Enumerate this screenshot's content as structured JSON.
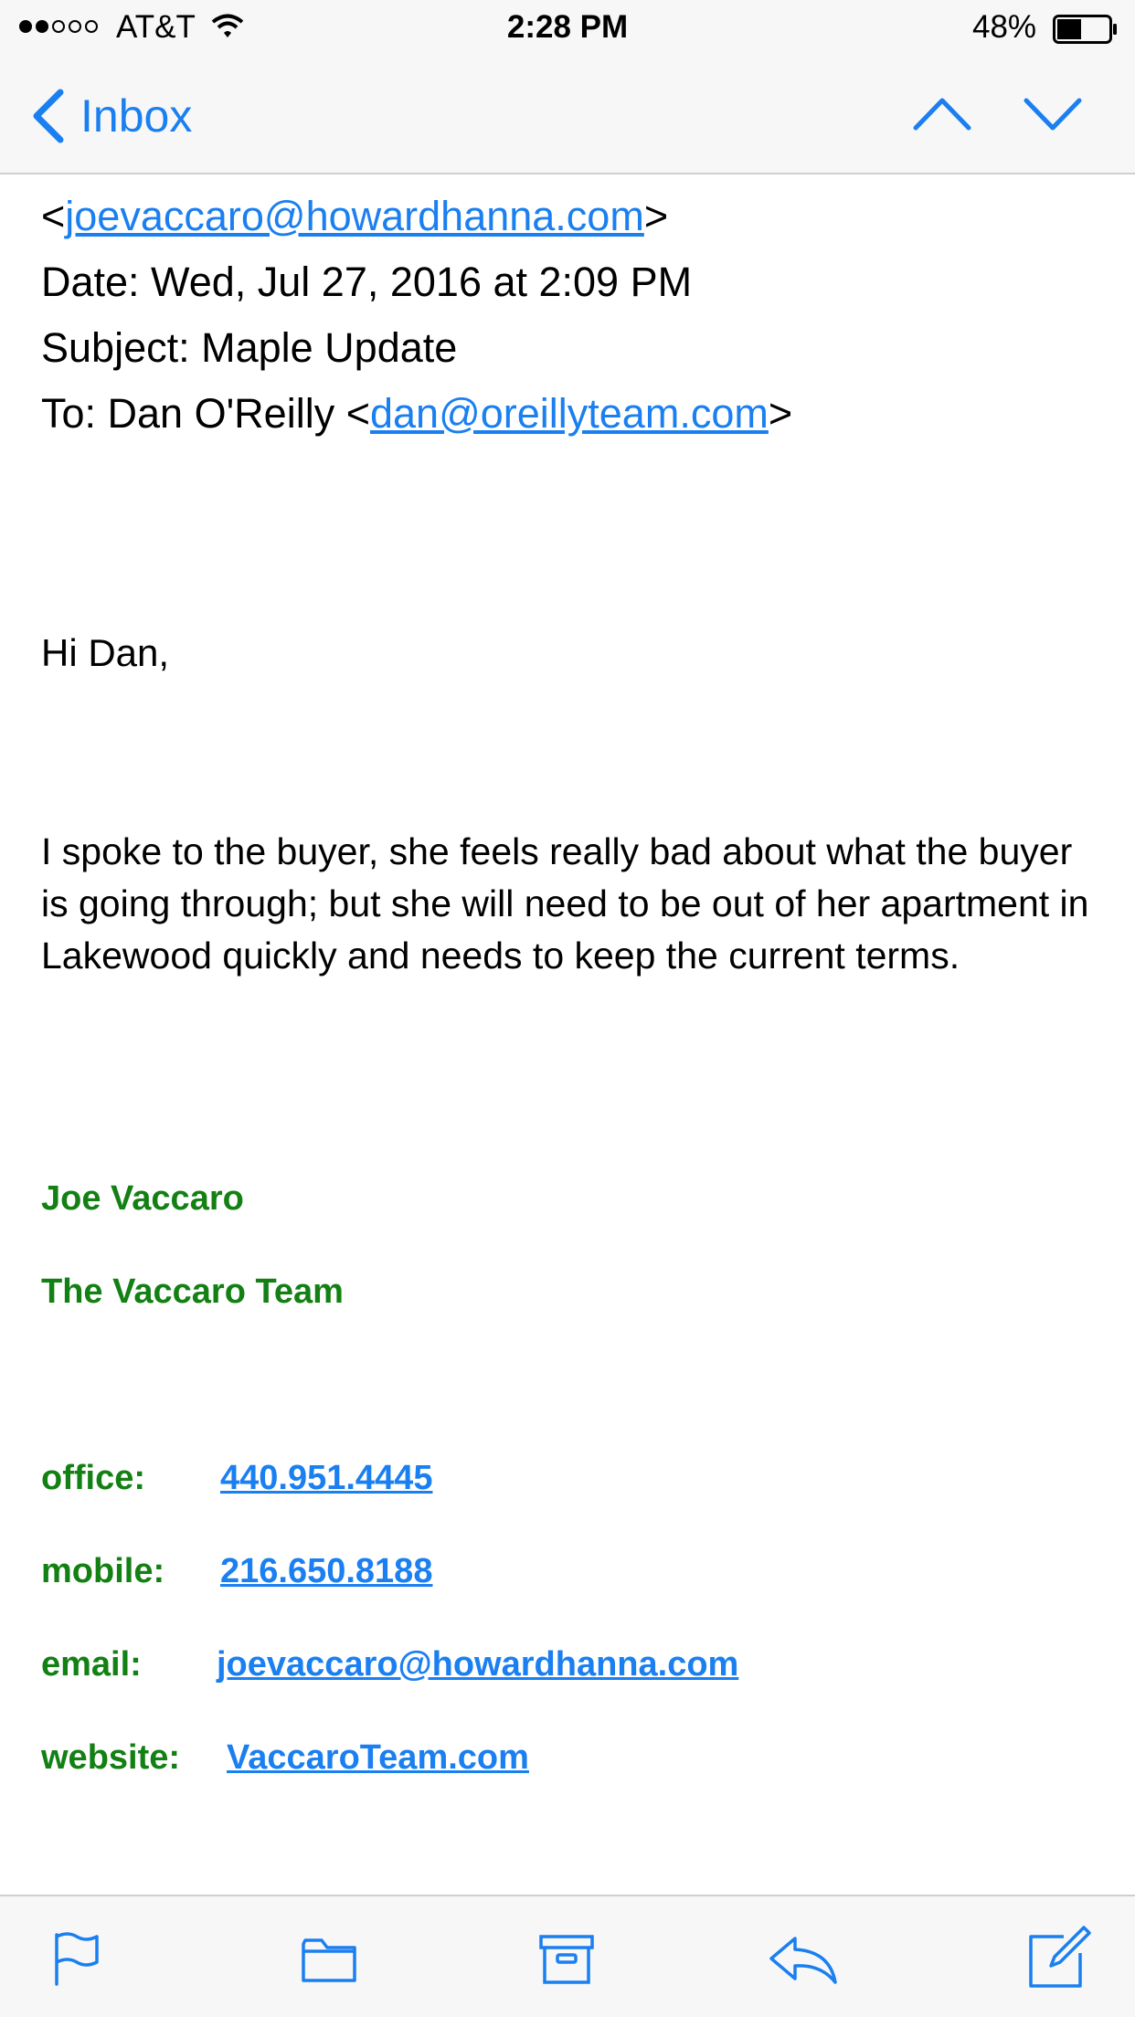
{
  "status_bar": {
    "carrier": "AT&T",
    "time": "2:28 PM",
    "battery_percent": "48%",
    "signal_filled": 2,
    "signal_total": 5,
    "battery_level": 0.48
  },
  "nav": {
    "back_label": "Inbox",
    "accent_color": "#1a7ff0",
    "prev_icon": "chevron-up-icon",
    "next_icon": "chevron-down-icon"
  },
  "message": {
    "from_open": "<",
    "from_email": "joevaccaro@howardhanna.com",
    "from_close": ">",
    "date": "Date: Wed, Jul 27, 2016 at 2:09 PM",
    "subject": "Subject: Maple Update",
    "to_prefix": "To: Dan O'Reilly <",
    "to_email": "dan@oreillyteam.com",
    "to_close": ">",
    "greeting": "Hi Dan,",
    "body": "I spoke to the buyer, she feels really bad about what the buyer is going through; but she will need to be out of her apartment in Lakewood quickly and needs to keep the current terms."
  },
  "signature": {
    "color": "#138013",
    "name": "Joe Vaccaro",
    "team": "The Vaccaro Team",
    "office_label": "office:",
    "office_value": "440.951.4445",
    "mobile_label": "mobile:",
    "mobile_value": "216.650.8188",
    "email_label": "email:",
    "email_value": "joevaccaro@howardhanna.com",
    "website_label": "website:",
    "website_value": "VaccaroTeam.com"
  },
  "toolbar": {
    "items": [
      "flag-icon",
      "folder-icon",
      "archive-icon",
      "reply-icon",
      "compose-icon"
    ]
  }
}
